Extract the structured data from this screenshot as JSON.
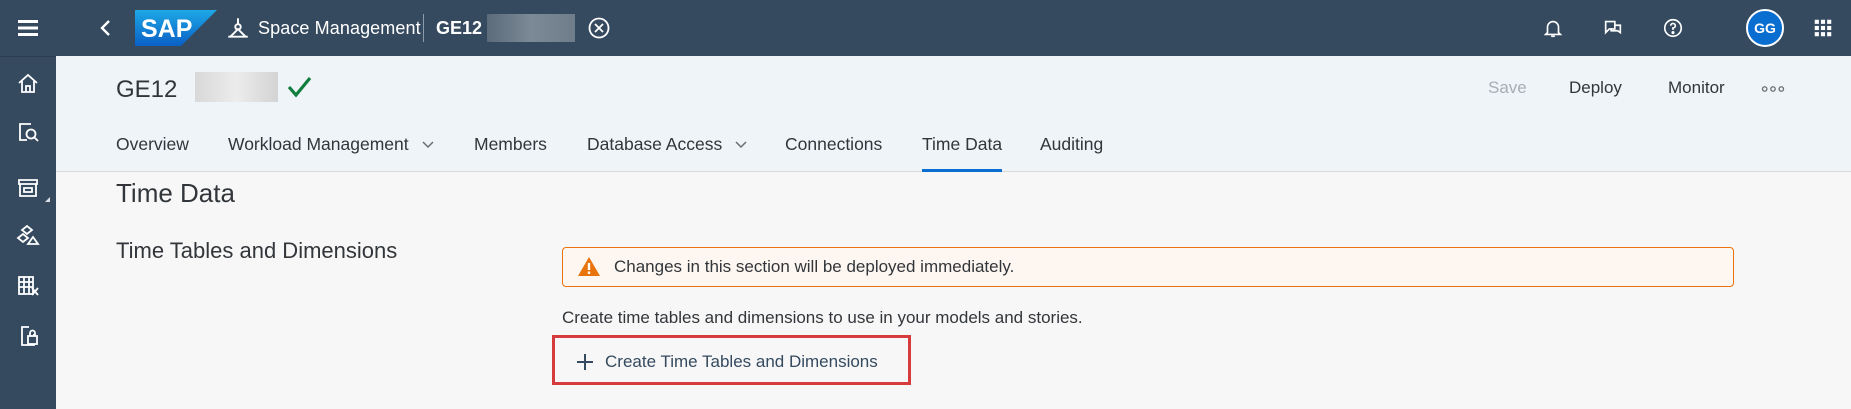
{
  "shell": {
    "app_title": "Space Management",
    "space_id": "GE12",
    "logo_text": "SAP",
    "avatar_initials": "GG",
    "icons": [
      "menu-icon",
      "back-icon",
      "close-circle-icon",
      "notification-bell-icon",
      "feedback-icon",
      "help-icon",
      "product-switch-icon"
    ]
  },
  "rail": [
    "home-icon",
    "data-builder-icon",
    "marketplace-icon",
    "business-builder-icon",
    "data-access-icon",
    "security-icon"
  ],
  "header": {
    "title": "GE12",
    "status": "deployed",
    "actions": {
      "save": "Save",
      "deploy": "Deploy",
      "monitor": "Monitor"
    }
  },
  "tabs": [
    {
      "label": "Overview"
    },
    {
      "label": "Workload Management"
    },
    {
      "label": "Members"
    },
    {
      "label": "Database Access"
    },
    {
      "label": "Connections"
    },
    {
      "label": "Time Data"
    },
    {
      "label": "Auditing"
    }
  ],
  "content": {
    "section_title": "Time Data",
    "subsection_title": "Time Tables and Dimensions",
    "warning": "Changes in this section will be deployed immediately.",
    "description": "Create time tables and dimensions to use in your models and stories.",
    "create_button": "Create Time Tables and Dimensions"
  },
  "colors": {
    "shell": "#354a5f",
    "accent": "#0a6ed1",
    "warning": "#e9730c",
    "success": "#107e3e",
    "highlight": "#d63c3c"
  }
}
